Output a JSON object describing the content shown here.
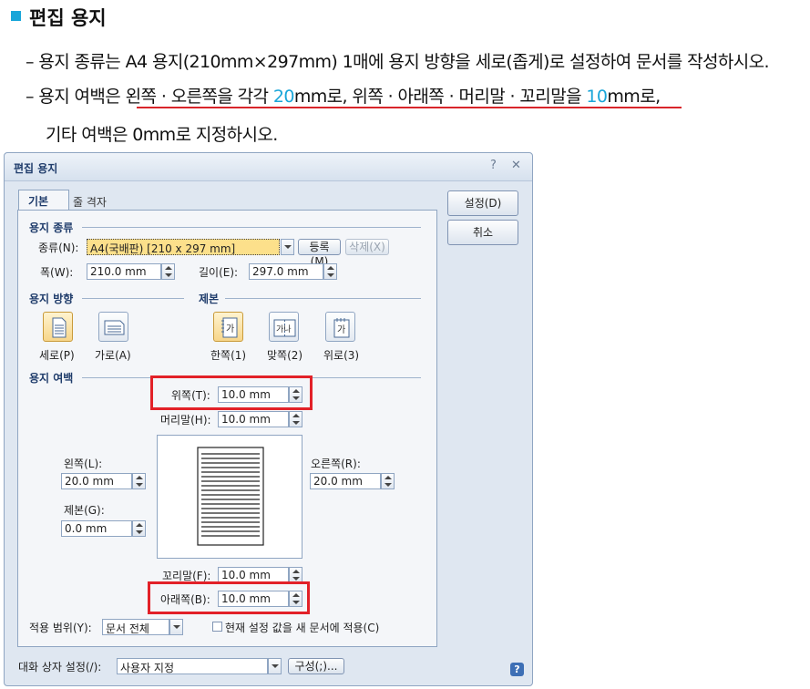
{
  "instructions": {
    "heading": "편집 용지",
    "line1": "– 용지 종류는 A4 용지(210mm×297mm) 1매에 용지 방향을 세로(좁게)로 설정하여 문서를 작성하시오.",
    "line2_prefix": "– 용지 여백은 ",
    "line2_a": "왼쪽 · 오른쪽을 각각 ",
    "line2_b": "20",
    "line2_c": "mm로, 위쪽 · 아래쪽 · 머리말 · 꼬리말을 ",
    "line2_d": "10",
    "line2_e": "mm로,",
    "line3": "기타 여백은 0mm로 지정하시오."
  },
  "dialog": {
    "title": "편집 용지",
    "help_glyph": "?",
    "close_glyph": "✕",
    "tabs": [
      "기본",
      "줄 격자"
    ],
    "ok_label": "설정(D)",
    "cancel_label": "취소",
    "paper_type": {
      "group": "용지 종류",
      "type_label": "종류(N):",
      "type_value": "A4(국배판) [210 x 297 mm]",
      "register_label": "등록(M)",
      "delete_label": "삭제(X)",
      "width_label": "폭(W):",
      "width_value": "210.0 mm",
      "length_label": "길이(E):",
      "length_value": "297.0 mm"
    },
    "orientation": {
      "group": "용지 방향",
      "portrait": "세로(P)",
      "landscape": "가로(A)"
    },
    "binding": {
      "group": "제본",
      "single": "한쪽(1)",
      "facing": "맞쪽(2)",
      "top": "위로(3)",
      "icon_char": "가",
      "icon_char_facing": "가나"
    },
    "margins": {
      "group": "용지 여백",
      "top_label": "위쪽(T):",
      "top_value": "10.0 mm",
      "header_label": "머리말(H):",
      "header_value": "10.0 mm",
      "left_label": "왼쪽(L):",
      "left_value": "20.0 mm",
      "right_label": "오른쪽(R):",
      "right_value": "20.0 mm",
      "gutter_label": "제본(G):",
      "gutter_value": "0.0 mm",
      "footer_label": "꼬리말(F):",
      "footer_value": "10.0 mm",
      "bottom_label": "아래쪽(B):",
      "bottom_value": "10.0 mm"
    },
    "apply": {
      "label": "적용 범위(Y):",
      "value": "문서 전체",
      "new_doc_label": "현재 설정 값을 새 문서에 적용(C)"
    },
    "footer": {
      "label": "대화 상자 설정(/):",
      "value": "사용자 지정",
      "config_label": "구성(;)..."
    }
  },
  "colors": {
    "accent": "#1aa6d9",
    "highlight": "#e22128"
  }
}
